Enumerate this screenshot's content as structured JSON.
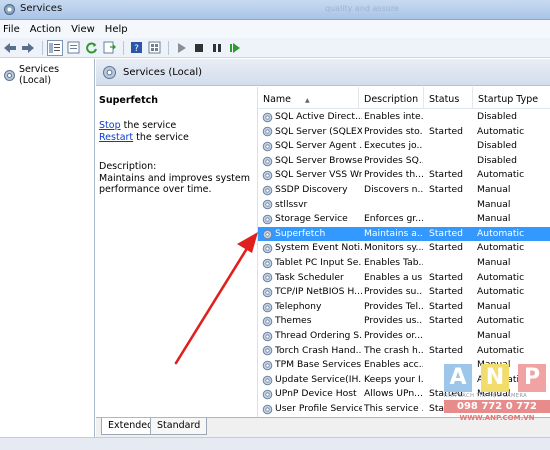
{
  "window": {
    "title": "Services",
    "title_faint": "quality and assure"
  },
  "menu": [
    "File",
    "Action",
    "View",
    "Help"
  ],
  "toolbar": [
    "back-icon",
    "forward-icon",
    "show-hide-tree-icon",
    "properties-icon",
    "refresh-icon",
    "export-icon",
    "help-icon",
    "view-icon",
    "play-icon",
    "stop-icon",
    "pause-icon",
    "restart-icon"
  ],
  "tree": {
    "root": "Services (Local)"
  },
  "header": {
    "title": "Services (Local)"
  },
  "detail": {
    "service": "Superfetch",
    "stop_link": "Stop",
    "stop_suffix": " the service",
    "restart_link": "Restart",
    "restart_suffix": " the service",
    "desc_label": "Description:",
    "desc_text": "Maintains and improves system performance over time."
  },
  "columns": {
    "name": "Name",
    "description": "Description",
    "status": "Status",
    "startup": "Startup Type"
  },
  "rows": [
    {
      "name": "SQL Active Direct...",
      "description": "Enables inte...",
      "status": "",
      "startup": "Disabled"
    },
    {
      "name": "SQL Server (SQLEX...",
      "description": "Provides sto...",
      "status": "Started",
      "startup": "Automatic"
    },
    {
      "name": "SQL Server Agent ...",
      "description": "Executes jo...",
      "status": "",
      "startup": "Disabled"
    },
    {
      "name": "SQL Server Browser",
      "description": "Provides SQ...",
      "status": "",
      "startup": "Disabled"
    },
    {
      "name": "SQL Server VSS Wr...",
      "description": "Provides th...",
      "status": "Started",
      "startup": "Automatic"
    },
    {
      "name": "SSDP Discovery",
      "description": "Discovers n...",
      "status": "Started",
      "startup": "Manual"
    },
    {
      "name": "stllssvr",
      "description": "",
      "status": "",
      "startup": "Manual"
    },
    {
      "name": "Storage Service",
      "description": "Enforces gr...",
      "status": "",
      "startup": "Manual"
    },
    {
      "name": "Superfetch",
      "description": "Maintains a...",
      "status": "Started",
      "startup": "Automatic",
      "selected": true
    },
    {
      "name": "System Event Noti...",
      "description": "Monitors sy...",
      "status": "Started",
      "startup": "Automatic"
    },
    {
      "name": "Tablet PC Input Se...",
      "description": "Enables Tab...",
      "status": "",
      "startup": "Manual"
    },
    {
      "name": "Task Scheduler",
      "description": "Enables a us...",
      "status": "Started",
      "startup": "Automatic"
    },
    {
      "name": "TCP/IP NetBIOS H...",
      "description": "Provides su...",
      "status": "Started",
      "startup": "Automatic"
    },
    {
      "name": "Telephony",
      "description": "Provides Tel...",
      "status": "Started",
      "startup": "Manual"
    },
    {
      "name": "Themes",
      "description": "Provides us...",
      "status": "Started",
      "startup": "Automatic"
    },
    {
      "name": "Thread Ordering S...",
      "description": "Provides or...",
      "status": "",
      "startup": "Manual"
    },
    {
      "name": "Torch Crash Hand...",
      "description": "The crash h...",
      "status": "Started",
      "startup": "Automatic"
    },
    {
      "name": "TPM Base Services",
      "description": "Enables acc...",
      "status": "",
      "startup": "Manual"
    },
    {
      "name": "Update Service(IH...",
      "description": "Keeps your I...",
      "status": "",
      "startup": "Automatic"
    },
    {
      "name": "UPnP Device Host",
      "description": "Allows UPn...",
      "status": "Started",
      "startup": "Manual"
    },
    {
      "name": "User Profile Service",
      "description": "This service ...",
      "status": "Started",
      "startup": "Automatic"
    }
  ],
  "tabs": [
    "Extended",
    "Standard"
  ],
  "watermark": {
    "letters": [
      "A",
      "N",
      "P"
    ],
    "tagline": "NHÀ SÁCH TIN HỌC CAMERA",
    "phone": "098 772 0 772",
    "url": "WWW.ANP.COM.VN"
  },
  "colors": {
    "selection": "#3399ff",
    "arrow": "#e0201c",
    "link": "#0b3cc9"
  }
}
